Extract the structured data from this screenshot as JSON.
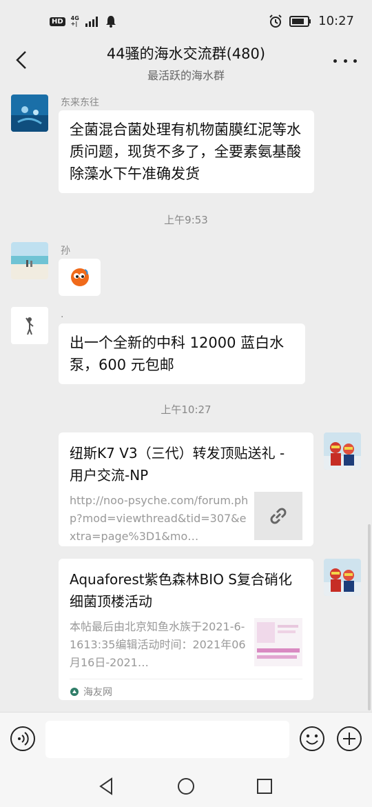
{
  "status_bar": {
    "hd": "HD",
    "network": "4G",
    "network_sub": "+|",
    "time": "10:27"
  },
  "header": {
    "title": "44骚的海水交流群(480)",
    "subtitle": "最活跃的海水群",
    "back_icon": "chevron-left-icon",
    "more_icon": "more-dots-icon"
  },
  "messages": [
    {
      "sender": "东来东往",
      "text": "全菌混合菌处理有机物菌膜红泥等水质问题，现货不多了，全要素氨基酸除藻水下午准确发货",
      "avatar": "diver-avatar"
    },
    {
      "timestamp": "上午9:53"
    },
    {
      "sender": "孙",
      "sticker": "orange-face-sticker",
      "avatar": "beach-avatar"
    },
    {
      "sender": ".",
      "text": "出一个全新的中科 12000 蓝白水泵，600 元包邮",
      "avatar": "figure-avatar"
    },
    {
      "timestamp": "上午10:27"
    },
    {
      "card_title": "纽斯K7 V3（三代）转发顶贴送礼 - 用户交流-NP",
      "card_desc": "http://noo-psyche.com/forum.php?mod=viewthread&tid=307&extra=page%3D1&mo…",
      "card_icon": "link-icon",
      "avatar": "self-avatar"
    },
    {
      "card_title": "Aquaforest紫色森林BIO S复合硝化细菌顶楼活动",
      "card_desc": "本帖最后由北京知鱼水族于2021-6-1613:35编辑活动时间：2021年06月16日-2021…",
      "card_source": "海友网",
      "avatar": "self-avatar"
    }
  ],
  "input_bar": {
    "placeholder": "",
    "voice_icon": "voice-icon",
    "emoji_icon": "emoji-icon",
    "plus_icon": "plus-icon"
  },
  "nav_bar": {
    "back_icon": "nav-back-icon",
    "home_icon": "nav-home-icon",
    "recents_icon": "nav-recents-icon"
  },
  "colors": {
    "background": "#ededed",
    "bubble": "#ffffff",
    "timestamp_text": "#888888"
  }
}
